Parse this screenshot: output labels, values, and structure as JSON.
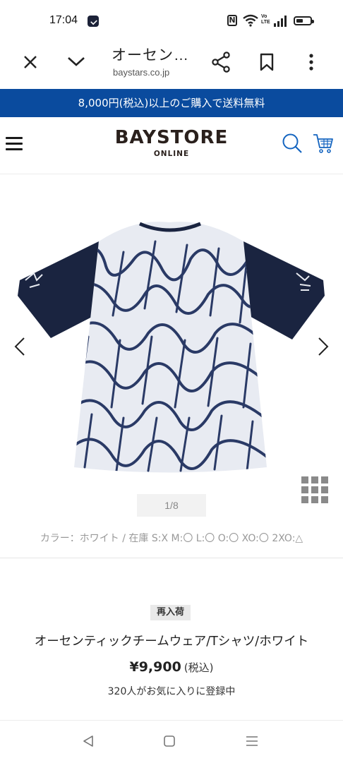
{
  "status_bar": {
    "time": "17:04",
    "nfc_label": "N",
    "volte_label": "Vo LTE"
  },
  "browser": {
    "title": "オーセン…",
    "url": "baystars.co.jp"
  },
  "banner": {
    "text": "8,000円(税込)以上のご購入で送料無料"
  },
  "site_header": {
    "logo_main": "BAYSTORE",
    "logo_sub": "ONLINE"
  },
  "gallery": {
    "counter": "1/8"
  },
  "product": {
    "stock_line": "カラー：ホワイト  /  在庫  S:X   M:〇   L:〇   O:〇   XO:〇   2XO:△",
    "badge": "再入荷",
    "name": "オーセンティックチームウェア/Tシャツ/ホワイト",
    "price": "¥9,900",
    "tax_label": "(税込)",
    "favorites": "320人がお気に入りに登録中"
  },
  "colors": {
    "banner_bg": "#0a4b9e",
    "logo": "#2a201c",
    "accent_icon": "#1565c0",
    "shirt_navy": "#1a2440"
  }
}
